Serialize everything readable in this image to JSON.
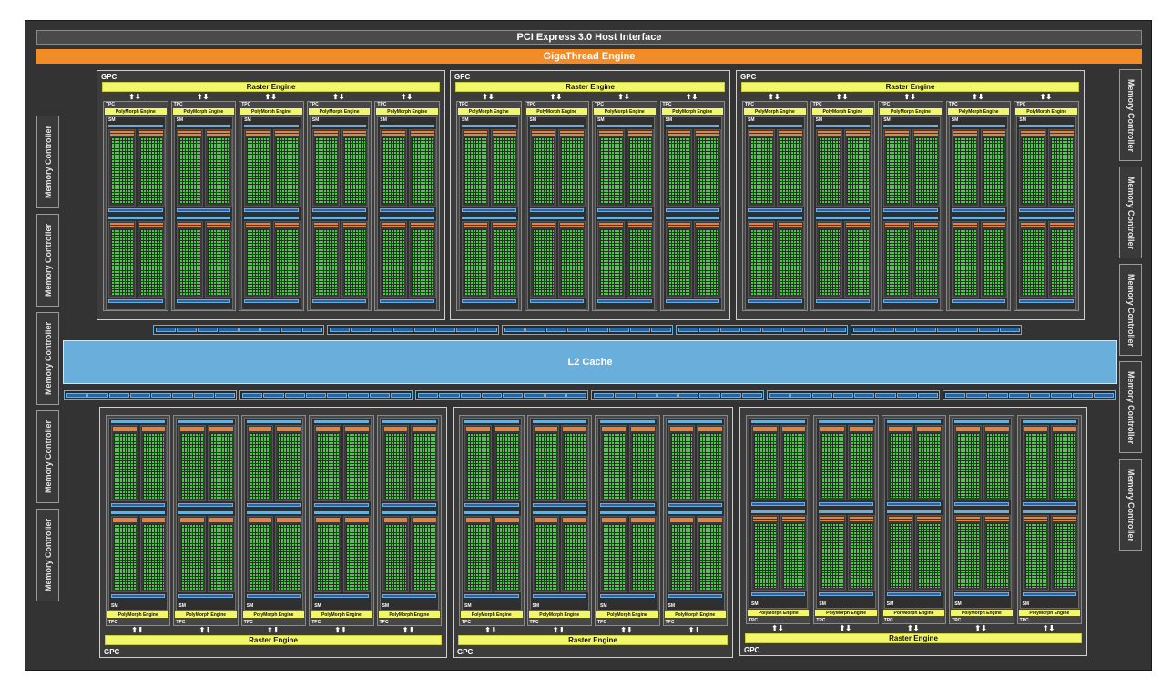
{
  "host_interface": "PCI Express 3.0 Host Interface",
  "gigathread": "GigaThread Engine",
  "l2_cache": "L2 Cache",
  "memory_controller_label": "Memory Controller",
  "gpc_label": "GPC",
  "raster_label": "Raster Engine",
  "tpc_label": "TPC",
  "polymorph_label": "PolyMorph Engine",
  "sm_label": "SM",
  "arrow_glyph": "⬆⬇",
  "colors": {
    "chip_bg": "#333333",
    "host_bar": "#4a4a4a",
    "gigathread": "#f28c28",
    "l2_cache": "#6aaedc",
    "raster": "#f2f66a",
    "cuda_core": "#3fd13a",
    "load_store": "#2e5fa8",
    "warp_scheduler": "#e8813a"
  },
  "structure": {
    "gpc_count": 6,
    "tpc_per_gpc": [
      5,
      4,
      5,
      5,
      4,
      5
    ],
    "memory_controllers_per_side": 5
  }
}
